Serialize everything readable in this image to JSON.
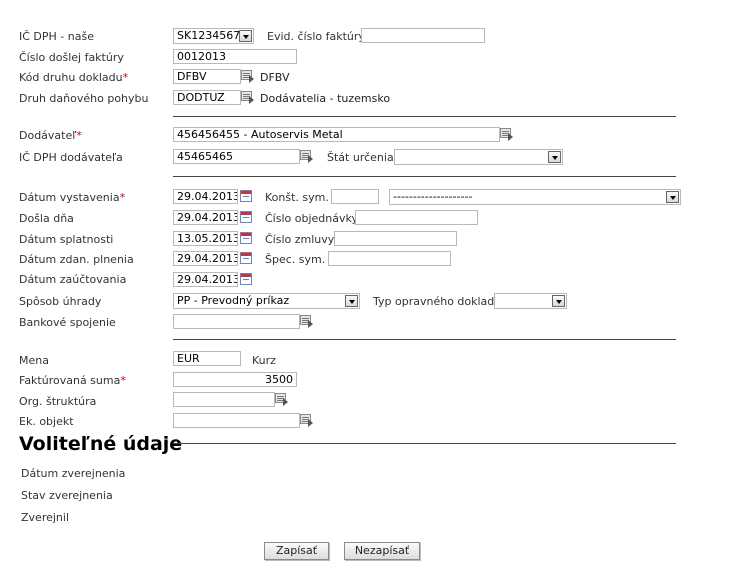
{
  "labels": {
    "ic_dph_nase": "IČ DPH - naše",
    "evid_cislo": "Evid. číslo faktúry",
    "cislo_faktury": "Číslo došlej faktúry",
    "kod_druhu": "Kód druhu dokladu",
    "druh_pohybu": "Druh daňového pohybu",
    "dodavatel": "Dodávateľ",
    "ic_dph_dodavatela": "IČ DPH dodávateľa",
    "stat_urcenia": "Štát určenia",
    "datum_vystavenia": "Dátum vystavenia",
    "konst_sym": "Konšt. sym.",
    "dosla_dna": "Došla dňa",
    "cislo_objednavky": "Číslo objednávky",
    "datum_splatnosti": "Dátum splatnosti",
    "cislo_zmluvy": "Číslo zmluvy",
    "datum_zdan": "Dátum zdan. plnenia",
    "spec_sym": "Špec. sym.",
    "datum_zauct": "Dátum zaúčtovania",
    "sposob_uhrady": "Spôsob úhrady",
    "typ_opravneho": "Typ opravného dokladu",
    "bankove_spojenie": "Bankové spojenie",
    "mena": "Mena",
    "kurz": "Kurz",
    "fakt_suma": "Faktúrovaná suma",
    "org_struktura": "Org. štruktúra",
    "ek_objekt": "Ek. objekt",
    "required_mark": "*"
  },
  "values": {
    "ic_dph_nase": "SK1234567",
    "evid_cislo": "",
    "cislo_faktury": "0012013",
    "kod_druhu": "DFBV",
    "kod_druhu_desc": "DFBV",
    "druh_pohybu": "DODTUZ",
    "druh_pohybu_desc": "Dodávatelia - tuzemsko",
    "dodavatel": "456456455 - Autoservis Metal",
    "ic_dph_dodavatela": "45465465",
    "stat_urcenia": "",
    "datum_vystavenia": "29.04.2013",
    "konst_sym": "",
    "konst_sym_select": "--------------------",
    "dosla_dna": "29.04.2013",
    "cislo_objednavky": "",
    "datum_splatnosti": "13.05.2013",
    "cislo_zmluvy": "",
    "datum_zdan": "29.04.2013",
    "spec_sym": "",
    "datum_zauct": "29.04.2013",
    "sposob_uhrady": "PP - Prevodný príkaz",
    "typ_opravneho": "",
    "bankove_spojenie": "",
    "mena": "EUR",
    "fakt_suma": "3500",
    "org_struktura": "",
    "ek_objekt": ""
  },
  "optional": {
    "heading": "Voliteľné údaje",
    "datum_zverejnenia": "Dátum zverejnenia",
    "stav_zverejnenia": "Stav zverejnenia",
    "zverejnil": "Zverejnil"
  },
  "buttons": {
    "save": "Zapísať",
    "cancel": "Nezapísať"
  }
}
